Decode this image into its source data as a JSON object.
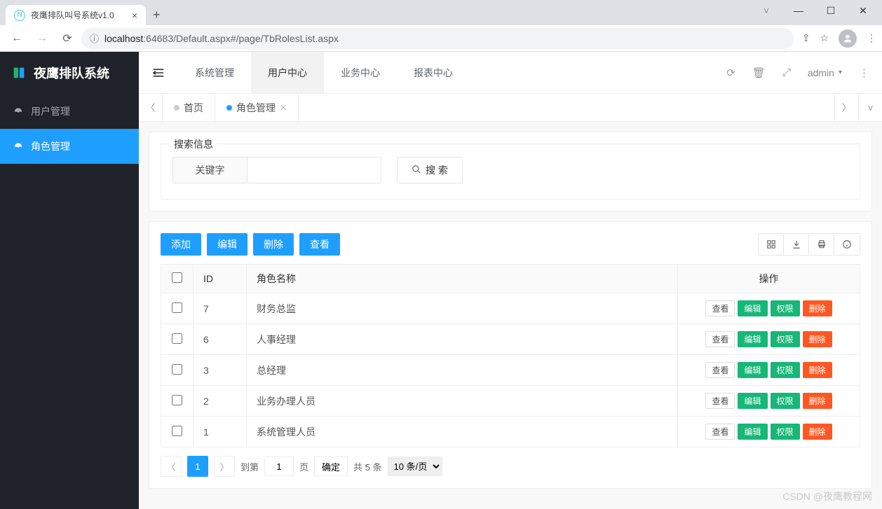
{
  "browser": {
    "tab_title": "夜鹰排队叫号系统v1.0",
    "url_host": "localhost",
    "url_rest": ":64683/Default.aspx#/page/TbRolesList.aspx"
  },
  "app": {
    "brand": "夜鹰排队系统"
  },
  "sidebar": {
    "items": [
      {
        "label": "用户管理",
        "active": false
      },
      {
        "label": "角色管理",
        "active": true
      }
    ]
  },
  "topmenu": {
    "items": [
      {
        "label": "系统管理",
        "active": false
      },
      {
        "label": "用户中心",
        "active": true
      },
      {
        "label": "业务中心",
        "active": false
      },
      {
        "label": "报表中心",
        "active": false
      }
    ],
    "user": "admin"
  },
  "page_tabs": [
    {
      "label": "首页",
      "active": false,
      "closable": false
    },
    {
      "label": "角色管理",
      "active": true,
      "closable": true
    }
  ],
  "search": {
    "legend": "搜索信息",
    "keyword_label": "关键字",
    "keyword_value": "",
    "button": "搜 索"
  },
  "toolbar": {
    "add": "添加",
    "edit": "编辑",
    "delete": "删除",
    "view": "查看"
  },
  "table": {
    "columns": {
      "id": "ID",
      "name": "角色名称",
      "op": "操作"
    },
    "row_buttons": {
      "view": "查看",
      "edit": "编辑",
      "perm": "权限",
      "del": "删除"
    },
    "rows": [
      {
        "id": "7",
        "name": "财务总监"
      },
      {
        "id": "6",
        "name": "人事经理"
      },
      {
        "id": "3",
        "name": "总经理"
      },
      {
        "id": "2",
        "name": "业务办理人员"
      },
      {
        "id": "1",
        "name": "系统管理人员"
      }
    ]
  },
  "pager": {
    "current": "1",
    "goto_prefix": "到第",
    "goto_value": "1",
    "goto_suffix": "页",
    "confirm": "确定",
    "total": "共 5 条",
    "page_size": "10 条/页"
  },
  "watermark": "CSDN @夜鹰教程网"
}
